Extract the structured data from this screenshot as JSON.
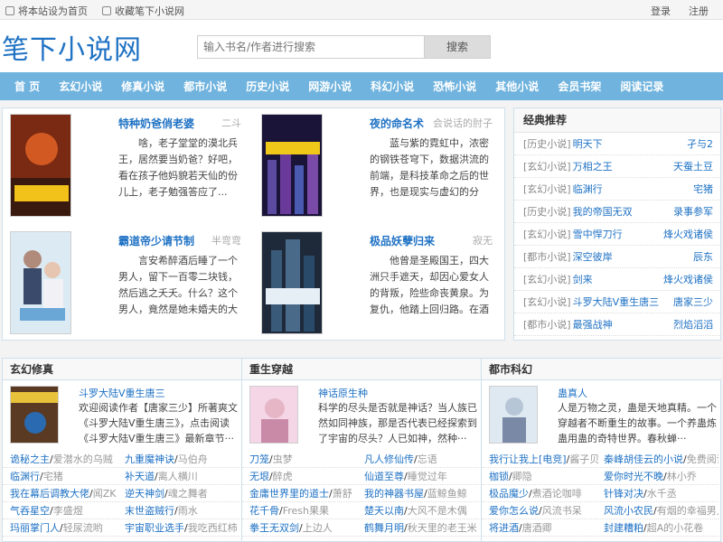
{
  "topbar": {
    "set_home": "将本站设为首页",
    "bookmark": "收藏笔下小说网",
    "login": "登录",
    "register": "注册"
  },
  "header": {
    "logo": "笔下小说网",
    "search_placeholder": "输入书名/作者进行搜索",
    "search_button": "搜索"
  },
  "nav": [
    "首 页",
    "玄幻小说",
    "修真小说",
    "都市小说",
    "历史小说",
    "网游小说",
    "科幻小说",
    "恐怖小说",
    "其他小说",
    "会员书架",
    "阅读记录"
  ],
  "featured": [
    {
      "title": "特种奶爸俏老婆",
      "author": "二斗",
      "desc": "啥，老子堂堂的漠北兵王，居然要当奶爸？好吧，看在孩子他妈貌若天仙的份儿上，老子勉强答应了...",
      "cover_color": "#c43a1a",
      "cover_label": "特种奶爸"
    },
    {
      "title": "夜的命名术",
      "author": "会说话的肘子",
      "desc": "蓝与紫的霓虹中，浓密的钢铁苍穹下，数据洪流的前端，是科技革命之后的世界，也是现实与虚幻的分界。 钢铁与身体，过去与",
      "cover_color": "#3a2a6a",
      "cover_label": "夜的命名术"
    },
    {
      "title": "霸道帝少请节制",
      "author": "半弯弯",
      "desc": "言安希醉酒后睡了一个男人，留下一百零二块钱，然后逃之夭夭。什么？这个男人，竟然是她未婚夫的大哥？一场豪赌，她被作为",
      "cover_color": "#9fc9e6",
      "cover_label": "霸道帝少"
    },
    {
      "title": "极品妖孽归来",
      "author": "寂无",
      "desc": "他曾是圣殿国王，四大洲只手遮天，却因心爱女人的背叛，险些命丧黄泉。为复仇，他踏上回归路。在酒吧昏暗的角落，有佳人绝",
      "cover_color": "#2b3a52",
      "cover_label": "妖孽归来"
    }
  ],
  "recommend": {
    "title": "经典推荐",
    "items": [
      {
        "cat": "[历史小说]",
        "book": "明天下",
        "author": "孑与2"
      },
      {
        "cat": "[玄幻小说]",
        "book": "万相之王",
        "author": "天蚕土豆"
      },
      {
        "cat": "[玄幻小说]",
        "book": "临渊行",
        "author": "宅猪"
      },
      {
        "cat": "[历史小说]",
        "book": "我的帝国无双",
        "author": "录事参军"
      },
      {
        "cat": "[玄幻小说]",
        "book": "雪中悍刀行",
        "author": "烽火戏诸侯"
      },
      {
        "cat": "[都市小说]",
        "book": "深空彼岸",
        "author": "辰东"
      },
      {
        "cat": "[玄幻小说]",
        "book": "剑来",
        "author": "烽火戏诸侯"
      },
      {
        "cat": "[玄幻小说]",
        "book": "斗罗大陆V重生唐三",
        "author": "唐家三少"
      },
      {
        "cat": "[都市小说]",
        "book": "最强战神",
        "author": "烈焰滔滔"
      }
    ]
  },
  "categories": [
    {
      "title": "玄幻修真",
      "top_title": "斗罗大陆V重生唐三",
      "top_desc": "欢迎阅读作者【唐家三少】所著爽文《斗罗大陆V重生唐三》，点击阅读《斗罗大陆V重生唐三》最新章节···",
      "cover_color": "#7a5a3a",
      "cover_label": "斗罗",
      "list": [
        [
          "诡秘之主",
          "爱潜水的乌贼",
          "九重魔神诀",
          "马伯舟"
        ],
        [
          "临渊行",
          "宅猪",
          "补天道",
          "离人横川"
        ],
        [
          "我在幕后调教大佬",
          "闻ZK",
          "逆天神剑",
          "魂之舞者"
        ],
        [
          "气吞星空",
          "李盛煜",
          "末世盗贼行",
          "雨水"
        ],
        [
          "玛丽掌门人",
          "轻尿流哟",
          "宇宙职业选手",
          "我吃西红柿"
        ]
      ]
    },
    {
      "title": "重生穿越",
      "top_title": "神话原生种",
      "top_desc": "科学的尽头是否就是神话？当人族已然如同神族，那是否代表已经探索到了宇宙的尽头？人已如神，然种···",
      "cover_color": "#d8a6c6",
      "cover_label": "神话",
      "list": [
        [
          "刀笼",
          "虫梦",
          "凡人修仙传",
          "忘语"
        ],
        [
          "无垠",
          "醉虎",
          "仙道至尊",
          "睡觉过年"
        ],
        [
          "金庸世界里的道士",
          "萧舒",
          "我的神器书屋",
          "蓝鲸鱼鲸"
        ],
        [
          "花千骨",
          "Fresh果果",
          "楚天以南",
          "大风不是木偶"
        ],
        [
          "拳王无双剑",
          "上边人",
          "鹤舞月明",
          "秋天里的老王米"
        ]
      ]
    },
    {
      "title": "都市科幻",
      "top_title": "蛊真人",
      "top_desc": "人是万物之灵，蛊是天地真精。一个穿越者不断重生的故事。一个养蛊炼蛊用蛊的奇特世界。春秋蝉···",
      "cover_color": "#c8d8e6",
      "cover_label": "蛊真人",
      "list": [
        [
          "我行让我上[电竞]",
          "酱子贝",
          "秦峰胡佳云的小说",
          "免费阅读"
        ],
        [
          "枷锁",
          "卿隐",
          "爱你时光不晚",
          "林小乔"
        ],
        [
          "极品魔少",
          "煮酒论咖啡",
          "针锋对决",
          "水千丞"
        ],
        [
          "爱你怎么说",
          "风流书呆",
          "风流小农民",
          "有烟的幸福男人"
        ],
        [
          "将进酒",
          "唐酒卿",
          "封建糟粕",
          "超A的小花卷"
        ]
      ]
    }
  ]
}
